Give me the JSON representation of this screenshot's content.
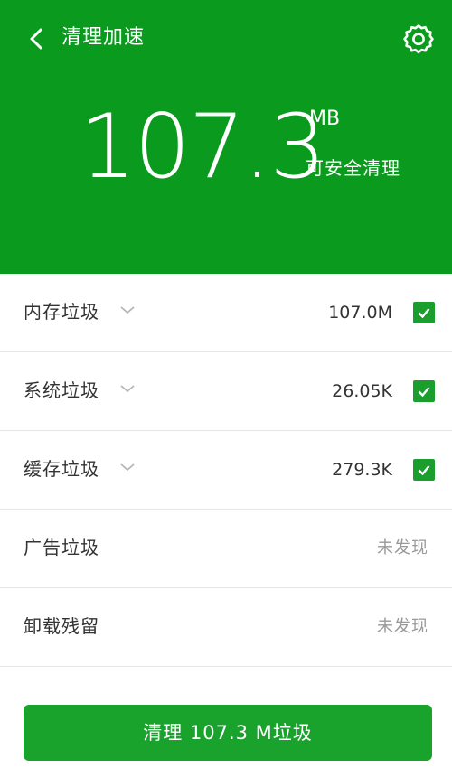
{
  "header": {
    "title": "清理加速",
    "amount": "107.3",
    "unit": "MB",
    "subtitle": "可安全清理",
    "icons": [
      "back-arrow-icon",
      "settings-gear-icon"
    ]
  },
  "items": [
    {
      "label": "内存垃圾",
      "value": "107.0M",
      "checked": true,
      "expandable": true
    },
    {
      "label": "系统垃圾",
      "value": "26.05K",
      "checked": true,
      "expandable": true
    },
    {
      "label": "缓存垃圾",
      "value": "279.3K",
      "checked": true,
      "expandable": true
    },
    {
      "label": "广告垃圾",
      "status": "未发现"
    },
    {
      "label": "卸载残留",
      "status": "未发现"
    }
  ],
  "action": {
    "label": "清理 107.3 M垃圾"
  },
  "colors": {
    "header_bg": "#0a9a1d",
    "button_bg": "#1aa32c",
    "checkbox": "#1b9e2e"
  }
}
